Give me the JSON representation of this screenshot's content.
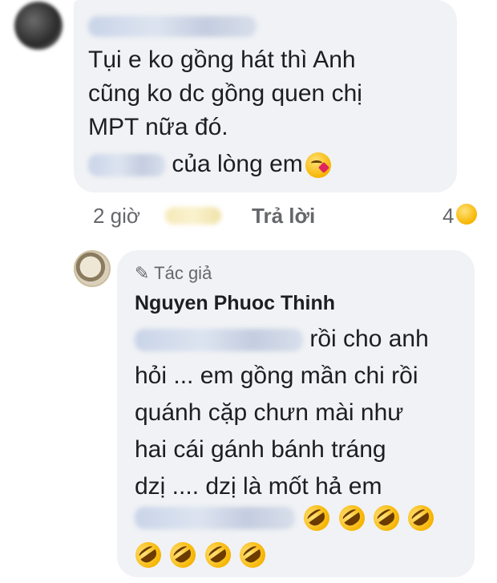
{
  "comment1": {
    "author_blurred": true,
    "lines": [
      "Tụi e ko gồng hát thì Anh",
      "cũng ko dc gồng quen chị",
      "MPT nữa đó."
    ],
    "line4_suffix": "của lòng em",
    "line4_emoji": "kissing-face-icon",
    "time": "2 giờ",
    "reply_label": "Trả lời",
    "reaction_count": "4",
    "reaction_icon": "laughing-face-icon"
  },
  "reply": {
    "author_tag": "Tác giả",
    "author_tag_icon": "pencil-icon",
    "author_name": "Nguyen Phuoc Thinh",
    "line1_suffix": "rồi cho anh",
    "lines": [
      "hỏi ... em gồng mần chi rồi",
      "quánh cặp chưn mài như",
      "hai cái gánh bánh tráng",
      "dzị .... dzị là mốt hả em"
    ],
    "emoji_icon": "rofl-face-icon"
  }
}
